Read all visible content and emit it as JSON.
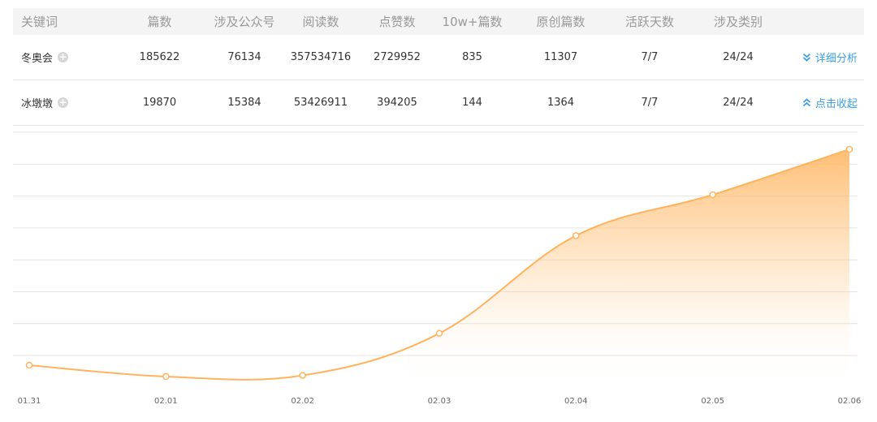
{
  "table": {
    "headers": [
      "关键词",
      "篇数",
      "涉及公众号",
      "阅读数",
      "点赞数",
      "10w+篇数",
      "原创篇数",
      "活跃天数",
      "涉及类别"
    ],
    "rows": [
      {
        "keyword": "冬奥会",
        "cells": [
          "185622",
          "76134",
          "357534716",
          "2729952",
          "835",
          "11307",
          "7/7",
          "24/24"
        ],
        "action_label": "详细分析",
        "action_icon": "double-chevron-down-icon"
      },
      {
        "keyword": "冰墩墩",
        "cells": [
          "19870",
          "15384",
          "53426911",
          "394205",
          "144",
          "1364",
          "7/7",
          "24/24"
        ],
        "action_label": "点击收起",
        "action_icon": "double-chevron-up-icon"
      }
    ]
  },
  "colors": {
    "accent": "#3aa0e8",
    "line": "#ffb35c",
    "header_bg": "#f4f4f4"
  },
  "chart_data": {
    "type": "area",
    "x": [
      "01.31",
      "02.01",
      "02.02",
      "02.03",
      "02.04",
      "02.05",
      "02.06"
    ],
    "values": [
      0.1,
      0.05,
      0.055,
      0.24,
      0.67,
      0.85,
      1.05
    ],
    "ylim": [
      0,
      1.1
    ],
    "grid": true,
    "y_ticks_visible": false
  }
}
